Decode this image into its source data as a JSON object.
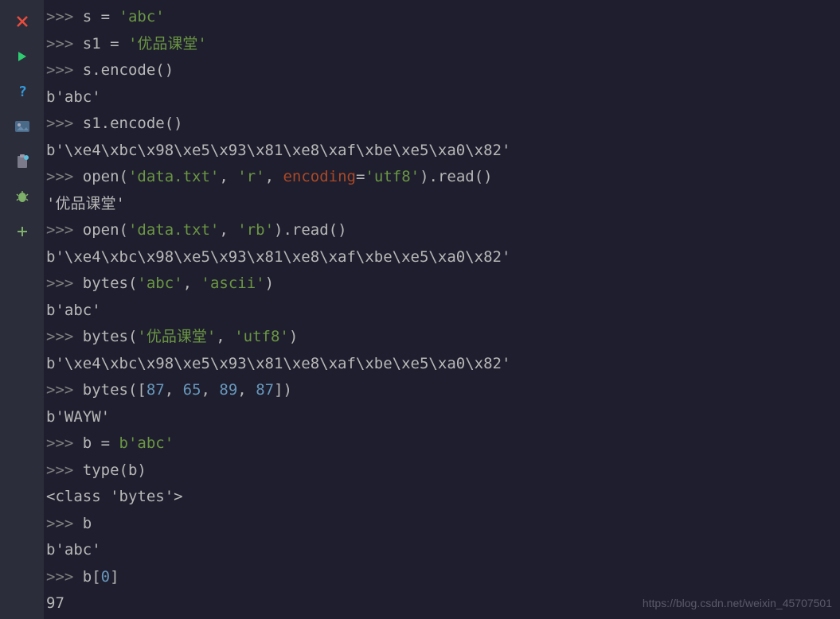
{
  "toolbar": {
    "icons": [
      {
        "name": "close-icon",
        "color": "#e74c3c"
      },
      {
        "name": "run-icon",
        "color": "#2ecc71"
      },
      {
        "name": "help-icon",
        "color": "#3498db"
      },
      {
        "name": "image-icon",
        "color": "#95a5a6"
      },
      {
        "name": "paste-icon",
        "color": "#95a5a6"
      },
      {
        "name": "debug-icon",
        "color": "#7fb069"
      },
      {
        "name": "add-icon",
        "color": "#7fb069"
      }
    ]
  },
  "console": {
    "prompt": ">>>",
    "lines": [
      {
        "type": "input",
        "tokens": [
          {
            "t": "s = ",
            "c": "func"
          },
          {
            "t": "'abc'",
            "c": "string"
          }
        ]
      },
      {
        "type": "input",
        "tokens": [
          {
            "t": "s1 = ",
            "c": "func"
          },
          {
            "t": "'优品课堂'",
            "c": "string"
          }
        ]
      },
      {
        "type": "input",
        "tokens": [
          {
            "t": "s.encode()",
            "c": "func"
          }
        ]
      },
      {
        "type": "output",
        "text": "b'abc'"
      },
      {
        "type": "input",
        "tokens": [
          {
            "t": "s1.encode()",
            "c": "func"
          }
        ]
      },
      {
        "type": "output",
        "text": "b'\\xe4\\xbc\\x98\\xe5\\x93\\x81\\xe8\\xaf\\xbe\\xe5\\xa0\\x82'"
      },
      {
        "type": "input",
        "tokens": [
          {
            "t": "open(",
            "c": "func"
          },
          {
            "t": "'data.txt'",
            "c": "string"
          },
          {
            "t": ", ",
            "c": "func"
          },
          {
            "t": "'r'",
            "c": "string"
          },
          {
            "t": ", ",
            "c": "func"
          },
          {
            "t": "encoding",
            "c": "param-name"
          },
          {
            "t": "=",
            "c": "func"
          },
          {
            "t": "'utf8'",
            "c": "string"
          },
          {
            "t": ").read()",
            "c": "func"
          }
        ]
      },
      {
        "type": "output",
        "text": "'优品课堂'"
      },
      {
        "type": "input",
        "tokens": [
          {
            "t": "open(",
            "c": "func"
          },
          {
            "t": "'data.txt'",
            "c": "string"
          },
          {
            "t": ", ",
            "c": "func"
          },
          {
            "t": "'rb'",
            "c": "string"
          },
          {
            "t": ").read()",
            "c": "func"
          }
        ]
      },
      {
        "type": "output",
        "text": "b'\\xe4\\xbc\\x98\\xe5\\x93\\x81\\xe8\\xaf\\xbe\\xe5\\xa0\\x82'"
      },
      {
        "type": "input",
        "tokens": [
          {
            "t": "bytes(",
            "c": "func"
          },
          {
            "t": "'abc'",
            "c": "string"
          },
          {
            "t": ", ",
            "c": "func"
          },
          {
            "t": "'ascii'",
            "c": "string"
          },
          {
            "t": ")",
            "c": "func"
          }
        ]
      },
      {
        "type": "output",
        "text": "b'abc'"
      },
      {
        "type": "input",
        "tokens": [
          {
            "t": "bytes(",
            "c": "func"
          },
          {
            "t": "'优品课堂'",
            "c": "string"
          },
          {
            "t": ", ",
            "c": "func"
          },
          {
            "t": "'utf8'",
            "c": "string"
          },
          {
            "t": ")",
            "c": "func"
          }
        ]
      },
      {
        "type": "output",
        "text": "b'\\xe4\\xbc\\x98\\xe5\\x93\\x81\\xe8\\xaf\\xbe\\xe5\\xa0\\x82'"
      },
      {
        "type": "input",
        "tokens": [
          {
            "t": "bytes([",
            "c": "func"
          },
          {
            "t": "87",
            "c": "number"
          },
          {
            "t": ", ",
            "c": "func"
          },
          {
            "t": "65",
            "c": "number"
          },
          {
            "t": ", ",
            "c": "func"
          },
          {
            "t": "89",
            "c": "number"
          },
          {
            "t": ", ",
            "c": "func"
          },
          {
            "t": "87",
            "c": "number"
          },
          {
            "t": "])",
            "c": "func"
          }
        ]
      },
      {
        "type": "output",
        "text": "b'WAYW'"
      },
      {
        "type": "input",
        "tokens": [
          {
            "t": "b = ",
            "c": "func"
          },
          {
            "t": "b'abc'",
            "c": "string"
          }
        ]
      },
      {
        "type": "input",
        "tokens": [
          {
            "t": "type(b)",
            "c": "func"
          }
        ]
      },
      {
        "type": "output",
        "text": "<class 'bytes'>"
      },
      {
        "type": "input",
        "tokens": [
          {
            "t": "b",
            "c": "func"
          }
        ]
      },
      {
        "type": "output",
        "text": "b'abc'"
      },
      {
        "type": "input",
        "tokens": [
          {
            "t": "b[",
            "c": "func"
          },
          {
            "t": "0",
            "c": "number"
          },
          {
            "t": "]",
            "c": "func"
          }
        ]
      },
      {
        "type": "output",
        "text": "97"
      }
    ]
  },
  "watermark": "https://blog.csdn.net/weixin_45707501"
}
